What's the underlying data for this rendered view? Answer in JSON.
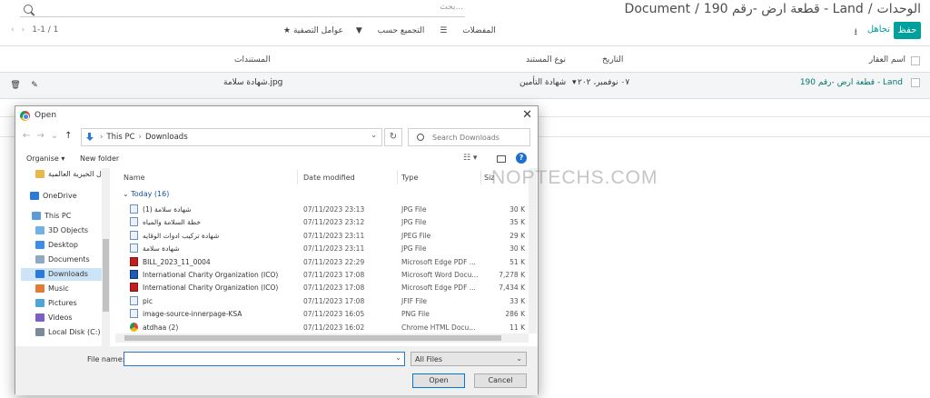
{
  "breadcrumb": {
    "root": "الوحدات",
    "record": "قطعة ارض -رقم 190 - Land",
    "current": "Document",
    "separator": "/"
  },
  "header": {
    "save": "حفظ",
    "discard": "تجاهل",
    "search_placeholder": "بحث..."
  },
  "toolbar": {
    "filters": "عوامل التصفية",
    "group_by": "التجميع حسب",
    "favorites": "المفضلات",
    "pager": "1-1 / 1"
  },
  "table": {
    "headers": {
      "property": "اسم العقار",
      "date": "التاريخ",
      "doc_type": "نوع المستند",
      "documents": "المستندات"
    },
    "row": {
      "property": "قطعة ارض -رقم 190 - Land",
      "date": "٠٧ نوفمبر، ٢٠٢",
      "doc_type": "شهادة التأمين",
      "document": "شهادة سلامة.jpg"
    }
  },
  "dialog": {
    "title": "Open",
    "path": [
      "This PC",
      "Downloads"
    ],
    "search_placeholder": "Search Downloads",
    "organise": "Organise",
    "new_folder": "New folder",
    "nav": [
      {
        "label": "ل الخيرية العالمية",
        "icon": "folder-icon"
      },
      {
        "label": "OneDrive",
        "icon": "cloud-icon"
      },
      {
        "label": "This PC",
        "icon": "pc-icon"
      },
      {
        "label": "3D Objects",
        "icon": "cube-icon"
      },
      {
        "label": "Desktop",
        "icon": "desktop-icon"
      },
      {
        "label": "Documents",
        "icon": "documents-icon"
      },
      {
        "label": "Downloads",
        "icon": "download-icon",
        "selected": true
      },
      {
        "label": "Music",
        "icon": "music-icon"
      },
      {
        "label": "Pictures",
        "icon": "pictures-icon"
      },
      {
        "label": "Videos",
        "icon": "videos-icon"
      },
      {
        "label": "Local Disk (C:)",
        "icon": "disk-icon"
      }
    ],
    "columns": [
      "Name",
      "Date modified",
      "Type",
      "Siz"
    ],
    "group_label": "Today (16)",
    "files": [
      {
        "name": "شهادة سلامة (1)",
        "date": "07/11/2023 23:13",
        "type": "JPG File",
        "size": "30 K",
        "kind": "img"
      },
      {
        "name": "خطة السلامة والمياه",
        "date": "07/11/2023 23:12",
        "type": "JPG File",
        "size": "35 K",
        "kind": "img"
      },
      {
        "name": "شهادة تركيب ادوات الوقايه",
        "date": "07/11/2023 23:11",
        "type": "JPEG File",
        "size": "29 K",
        "kind": "img"
      },
      {
        "name": "شهادة سلامة",
        "date": "07/11/2023 23:11",
        "type": "JPG File",
        "size": "30 K",
        "kind": "img"
      },
      {
        "name": "BILL_2023_11_0004",
        "date": "07/11/2023 22:29",
        "type": "Microsoft Edge PDF ...",
        "size": "51 K",
        "kind": "pdf"
      },
      {
        "name": "International Charity Organization (ICO)",
        "date": "07/11/2023 17:08",
        "type": "Microsoft Word Docu...",
        "size": "7,278 K",
        "kind": "doc"
      },
      {
        "name": "International Charity Organization (ICO)",
        "date": "07/11/2023 17:08",
        "type": "Microsoft Edge PDF ...",
        "size": "7,434 K",
        "kind": "pdf"
      },
      {
        "name": "pic",
        "date": "07/11/2023 17:08",
        "type": "JFIF File",
        "size": "33 K",
        "kind": "img"
      },
      {
        "name": "image-source-innerpage-KSA",
        "date": "07/11/2023 16:05",
        "type": "PNG File",
        "size": "286 K",
        "kind": "img"
      },
      {
        "name": "atdhaa (2)",
        "date": "07/11/2023 16:02",
        "type": "Chrome HTML Docu...",
        "size": "11 K",
        "kind": "html"
      }
    ],
    "file_name_label": "File name:",
    "file_name_value": "",
    "file_type": "All Files",
    "open": "Open",
    "cancel": "Cancel"
  },
  "watermark": "NOPTECHS.COM"
}
